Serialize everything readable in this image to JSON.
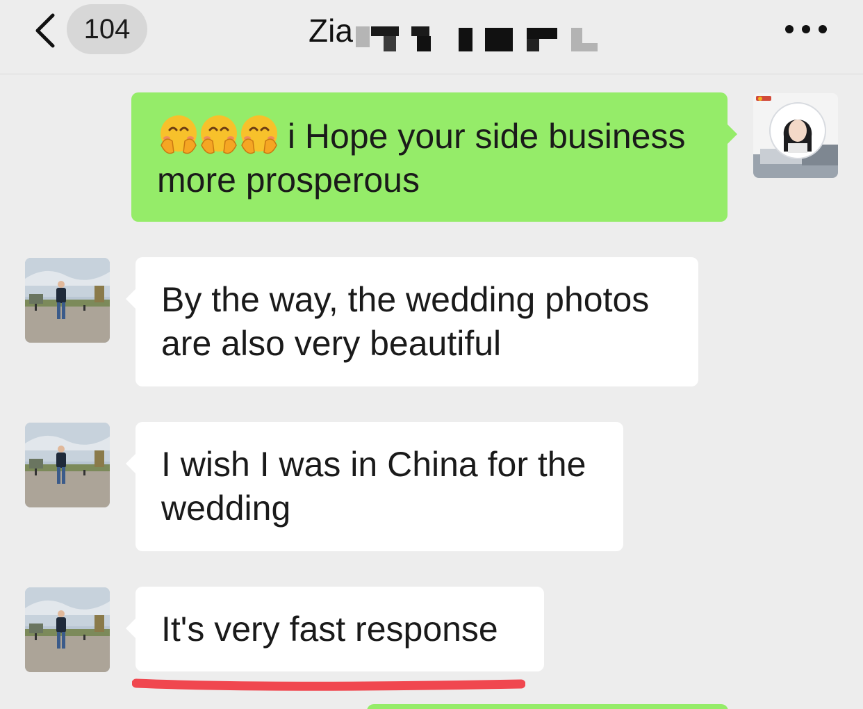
{
  "header": {
    "back_icon": "chevron-left-icon",
    "unread_count": "104",
    "title": "Zia",
    "more_icon": "ellipsis-icon"
  },
  "messages": [
    {
      "direction": "outgoing",
      "emoji_icon": "hugging-face-emoji",
      "emoji_count": 3,
      "text": "i Hope your side business more prosperous"
    },
    {
      "direction": "incoming",
      "text": "By the way, the wedding photos are also very beautiful"
    },
    {
      "direction": "incoming",
      "text": "I wish I was in China for the wedding"
    },
    {
      "direction": "incoming",
      "text": "It's very fast response",
      "highlight_color": "#f0474f"
    }
  ],
  "colors": {
    "background": "#ededed",
    "outgoing_bubble": "#95ec69",
    "incoming_bubble": "#ffffff",
    "badge": "#d7d7d7"
  }
}
